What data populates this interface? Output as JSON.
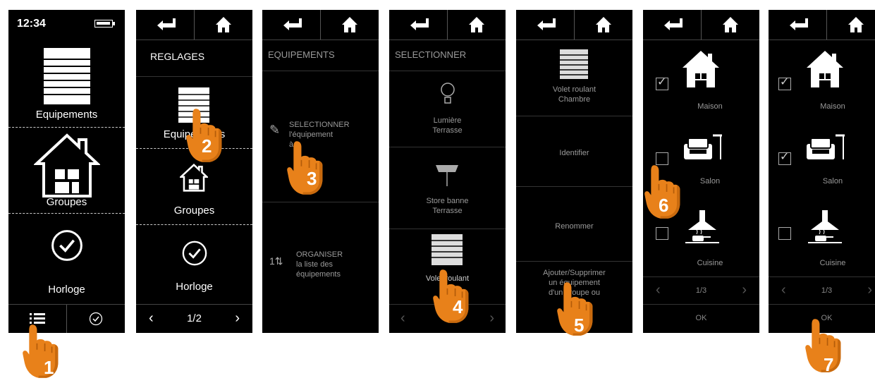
{
  "screen1": {
    "clock": "12:34",
    "items": [
      "Equipements",
      "Groupes",
      "Horloge"
    ]
  },
  "screen2": {
    "header": "REGLAGES",
    "items": [
      "Equipements",
      "Groupes",
      "Horloge"
    ],
    "pager": "1/2"
  },
  "screen3": {
    "header": "EQUIPEMENTS",
    "select_line1": "SELECTIONNER",
    "select_line2": "l'équipement",
    "select_line3": "à",
    "organize_line1": "ORGANISER",
    "organize_line2": "la liste des",
    "organize_line3": "équipements"
  },
  "screen4": {
    "header": "SELECTIONNER",
    "items": [
      {
        "line1": "Lumière",
        "line2": "Terrasse"
      },
      {
        "line1": "Store banne",
        "line2": "Terrasse"
      },
      {
        "line1": "Volet roulant",
        "line2": "Cha"
      }
    ]
  },
  "screen5": {
    "device_line1": "Volet roulant",
    "device_line2": "Chambre",
    "options": [
      "Identifier",
      "Renommer"
    ],
    "addremove_line1": "Ajouter/Supprimer",
    "addremove_line2": "un équipement",
    "addremove_line3": "d'un groupe ou",
    "addremove_line4": "d"
  },
  "screen6": {
    "groups": [
      "Maison",
      "Salon",
      "Cuisine"
    ],
    "checked": [
      true,
      false,
      false
    ],
    "pager": "1/3",
    "ok": "OK"
  },
  "screen7": {
    "groups": [
      "Maison",
      "Salon",
      "Cuisine"
    ],
    "checked": [
      true,
      true,
      false
    ],
    "pager": "1/3",
    "ok": "OK"
  },
  "steps": [
    "1",
    "2",
    "3",
    "4",
    "5",
    "6",
    "7"
  ],
  "colors": {
    "accent": "#E8811A",
    "accent_dark": "#C96A0E",
    "screen_bg": "#000000"
  }
}
